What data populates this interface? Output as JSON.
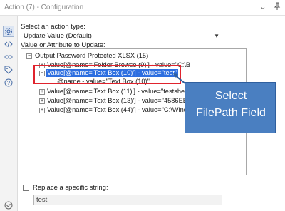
{
  "window": {
    "title": "Action (7) - Configuration"
  },
  "sidebar": {
    "items": [
      {
        "icon": "gear-icon"
      },
      {
        "icon": "code-icon"
      },
      {
        "icon": "link-icon"
      },
      {
        "icon": "tag-icon"
      },
      {
        "icon": "help-icon"
      }
    ],
    "footer_icon": "check-circle-icon"
  },
  "action": {
    "label": "Select an action type:",
    "selected": "Update Value (Default)"
  },
  "tree": {
    "label": "Value or Attribute to Update:",
    "root": "Output Password Protected XLSX (15)",
    "rows": [
      "Value[@name='Folder Browse (9)'] - value=\"C:\\B",
      "Value[@name='Text Box (10)'] - value=\"test\"",
      "@name - value=\"Text Box (10)\"",
      "Value[@name='Text Box (11)'] - value=\"testshe",
      "Value[@name='Text Box (13)'] - value=\"4586EE9",
      "Value[@name='Text Box (44)'] - value=\"C:\\Windo"
    ]
  },
  "callout": {
    "line1": "Select",
    "line2": "FilePath Field"
  },
  "replace": {
    "label": "Replace a specific string:",
    "checked": false,
    "value": "test"
  },
  "colors": {
    "selection": "#2e6fe0",
    "highlight_border": "#e0232d",
    "callout_fill": "#4a7fc1"
  }
}
